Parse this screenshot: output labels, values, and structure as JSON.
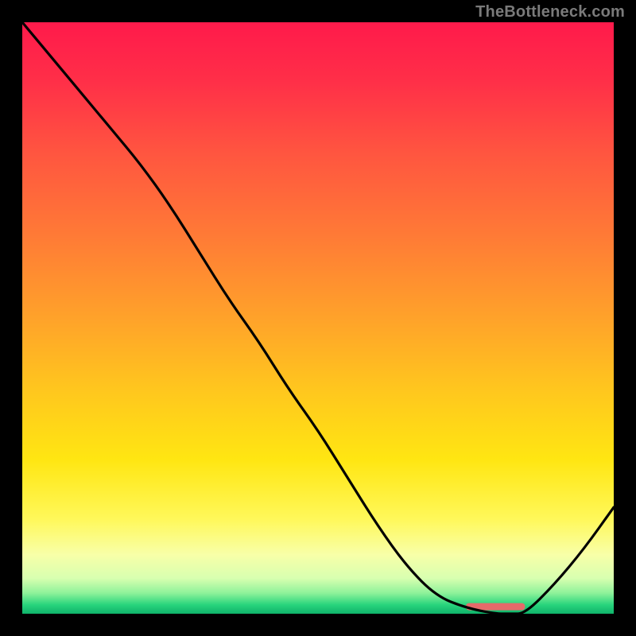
{
  "watermark": "TheBottleneck.com",
  "chart_data": {
    "type": "line",
    "title": "",
    "xlabel": "",
    "ylabel": "",
    "xlim": [
      0,
      100
    ],
    "ylim": [
      0,
      100
    ],
    "x": [
      0,
      5,
      10,
      15,
      20,
      25,
      30,
      35,
      40,
      45,
      50,
      55,
      60,
      65,
      70,
      75,
      80,
      82.5,
      85,
      90,
      95,
      100
    ],
    "values": [
      100,
      94,
      88,
      82,
      76,
      69,
      61,
      53,
      46,
      38,
      31,
      23,
      15,
      8,
      3,
      1,
      0,
      0,
      0,
      5,
      11,
      18
    ],
    "marker": {
      "x_start": 75,
      "x_end": 85,
      "y": 1.2,
      "color": "#e66a6a"
    },
    "gradient_stops": [
      {
        "offset": 0.0,
        "color": "#ff1a4b"
      },
      {
        "offset": 0.1,
        "color": "#ff2f48"
      },
      {
        "offset": 0.22,
        "color": "#ff5540"
      },
      {
        "offset": 0.36,
        "color": "#ff7a36"
      },
      {
        "offset": 0.5,
        "color": "#ffa22a"
      },
      {
        "offset": 0.62,
        "color": "#ffc61e"
      },
      {
        "offset": 0.74,
        "color": "#ffe612"
      },
      {
        "offset": 0.84,
        "color": "#fff85a"
      },
      {
        "offset": 0.9,
        "color": "#f8ffa8"
      },
      {
        "offset": 0.94,
        "color": "#d8ffb0"
      },
      {
        "offset": 0.965,
        "color": "#8ef29a"
      },
      {
        "offset": 0.985,
        "color": "#28d47c"
      },
      {
        "offset": 1.0,
        "color": "#0fb36a"
      }
    ]
  }
}
